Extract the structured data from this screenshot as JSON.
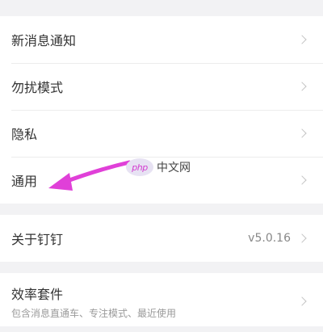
{
  "settings_group_1": {
    "items": [
      {
        "label": "新消息通知"
      },
      {
        "label": "勿扰模式"
      },
      {
        "label": "隐私"
      },
      {
        "label": "通用"
      }
    ]
  },
  "settings_group_2": {
    "items": [
      {
        "label": "关于钉钉",
        "value": "v5.0.16"
      }
    ]
  },
  "settings_group_3": {
    "items": [
      {
        "label": "效率套件",
        "subtitle": "包含消息直通车、专注模式、最近使用"
      }
    ]
  },
  "annotation": {
    "arrow_color": "#e040d8"
  },
  "watermark": {
    "logo_text": "php",
    "site_text": "中文网"
  }
}
